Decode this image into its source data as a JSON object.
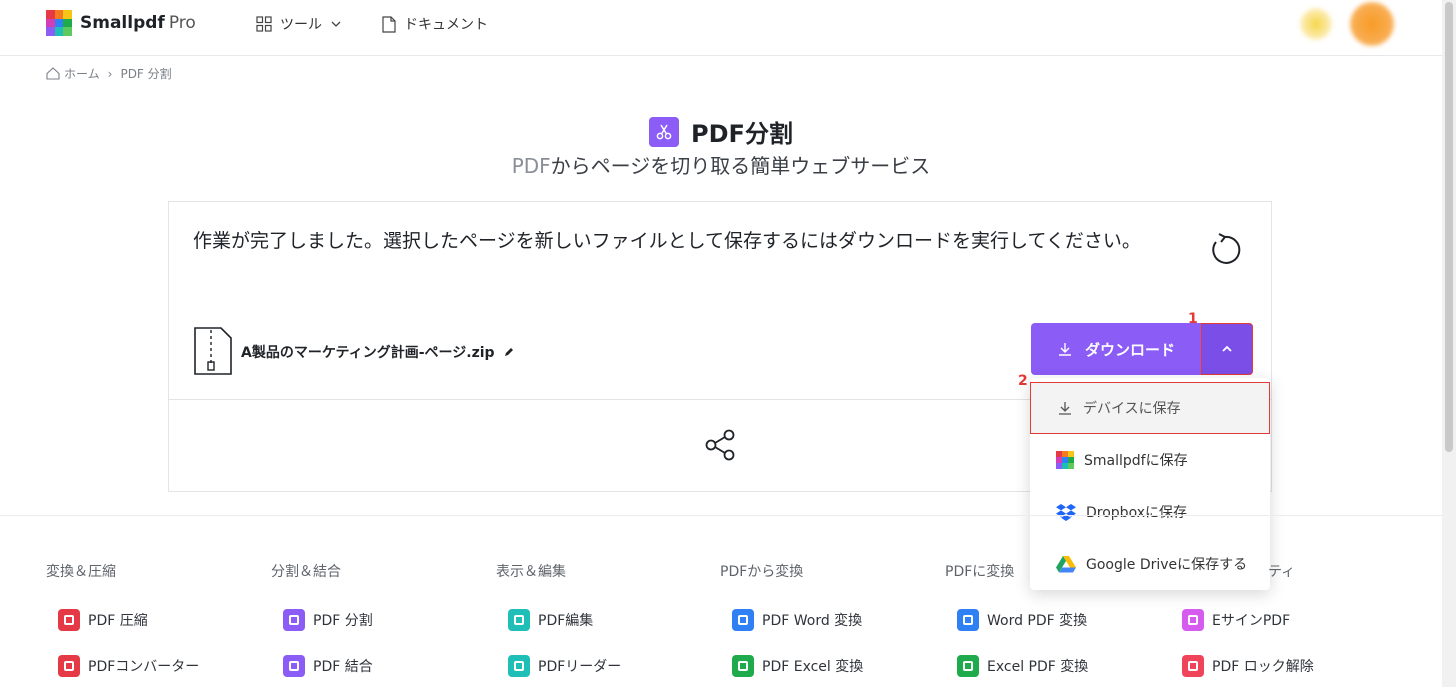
{
  "app": {
    "brand": "Smallpdf",
    "brand_tier": "Pro"
  },
  "nav": {
    "tools_label": "ツール",
    "documents_label": "ドキュメント"
  },
  "breadcrumb": {
    "home": "ホーム",
    "separator": "›",
    "current": "PDF 分割"
  },
  "page": {
    "title": "PDF分割",
    "subtitle_prefix": "PDF",
    "subtitle_rest": "からページを切り取る簡単ウェブサービス"
  },
  "result": {
    "message": "作業が完了しました。選択したページを新しいファイルとして保存するにはダウンロードを実行してください。",
    "file_name": "A製品のマーケティング計画-ページ.zip",
    "download_label": "ダウンロード"
  },
  "annotations": {
    "toggle": "1",
    "device_option": "2"
  },
  "dropdown": {
    "items": [
      {
        "label": "デバイスに保存",
        "icon": "download-icon"
      },
      {
        "label": "Smallpdfに保存",
        "icon": "smallpdf-logo-icon"
      },
      {
        "label": "Dropboxに保存",
        "icon": "dropbox-icon"
      },
      {
        "label": "Google Driveに保存する",
        "icon": "google-drive-icon"
      }
    ]
  },
  "footer": {
    "columns": [
      {
        "heading": "変換＆圧縮",
        "links": [
          {
            "label": "PDF 圧縮",
            "color": "#e53945"
          },
          {
            "label": "PDFコンバーター",
            "color": "#e53945"
          }
        ]
      },
      {
        "heading": "分割＆結合",
        "links": [
          {
            "label": "PDF 分割",
            "color": "#8b5cf6"
          },
          {
            "label": "PDF 結合",
            "color": "#8b5cf6"
          }
        ]
      },
      {
        "heading": "表示＆編集",
        "links": [
          {
            "label": "PDF編集",
            "color": "#1fbfb8"
          },
          {
            "label": "PDFリーダー",
            "color": "#1fbfb8"
          }
        ]
      },
      {
        "heading": "PDFから変換",
        "links": [
          {
            "label": "PDF Word 変換",
            "color": "#2f7ff5"
          },
          {
            "label": "PDF Excel 変換",
            "color": "#1faa4c"
          }
        ]
      },
      {
        "heading": "PDFに変換",
        "links": [
          {
            "label": "Word PDF 変換",
            "color": "#2f7ff5"
          },
          {
            "label": "Excel PDF 変換",
            "color": "#1faa4c"
          }
        ]
      },
      {
        "heading": "ティ",
        "links": [
          {
            "label": "EサインPDF",
            "color": "#d65cf0"
          },
          {
            "label": "PDF ロック解除",
            "color": "#f0445a"
          }
        ]
      }
    ]
  },
  "colors": {
    "accent": "#8b5cf6",
    "annotation": "#e53935"
  }
}
